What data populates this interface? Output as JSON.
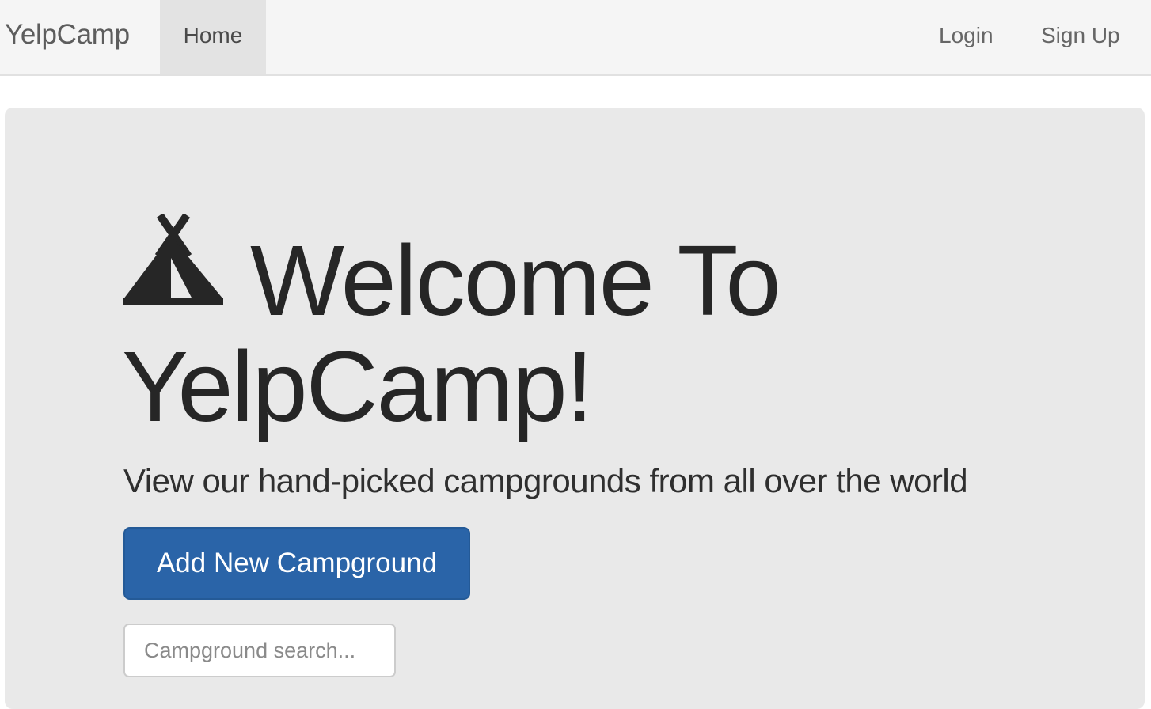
{
  "navbar": {
    "brand": "YelpCamp",
    "home": "Home",
    "login": "Login",
    "signup": "Sign Up"
  },
  "hero": {
    "icon": "tent-icon",
    "title_line1": "Welcome To",
    "title_line2": "YelpCamp!",
    "subtitle": "View our hand-picked campgrounds from all over the world",
    "button_label": "Add New Campground",
    "search_placeholder": "Campground search..."
  },
  "colors": {
    "navbar_bg": "#f5f5f5",
    "jumbotron_bg": "#e9e9e9",
    "primary_button": "#2a64a8",
    "text_dark": "#262626"
  }
}
